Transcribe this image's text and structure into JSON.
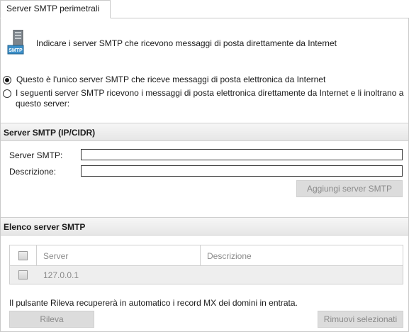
{
  "tab": {
    "label": "Server SMTP perimetrali"
  },
  "intro": {
    "icon_label": "SMTP",
    "text": "Indicare i server SMTP che ricevono messaggi di posta direttamente da Internet"
  },
  "radios": [
    {
      "label": "Questo è l'unico server SMTP che riceve messaggi di posta elettronica da Internet",
      "checked": true
    },
    {
      "label": "I seguenti server SMTP ricevono i messaggi di posta elettronica direttamente da Internet e li inoltrano a questo server:",
      "checked": false
    }
  ],
  "server_section": {
    "title": "Server SMTP (IP/CIDR)",
    "server_label": "Server SMTP:",
    "server_value": "",
    "description_label": "Descrizione:",
    "description_value": "",
    "add_button": "Aggiungi server SMTP"
  },
  "list_section": {
    "title": "Elenco server SMTP",
    "columns": [
      "Server",
      "Descrizione"
    ],
    "rows": [
      {
        "server": "127.0.0.1",
        "description": ""
      }
    ]
  },
  "footer": {
    "note": "Il pulsante Rileva recupererà in automatico i record MX dei domini in entrata.",
    "detect_button": "Rileva",
    "remove_button": "Rimuovi selezionati"
  }
}
